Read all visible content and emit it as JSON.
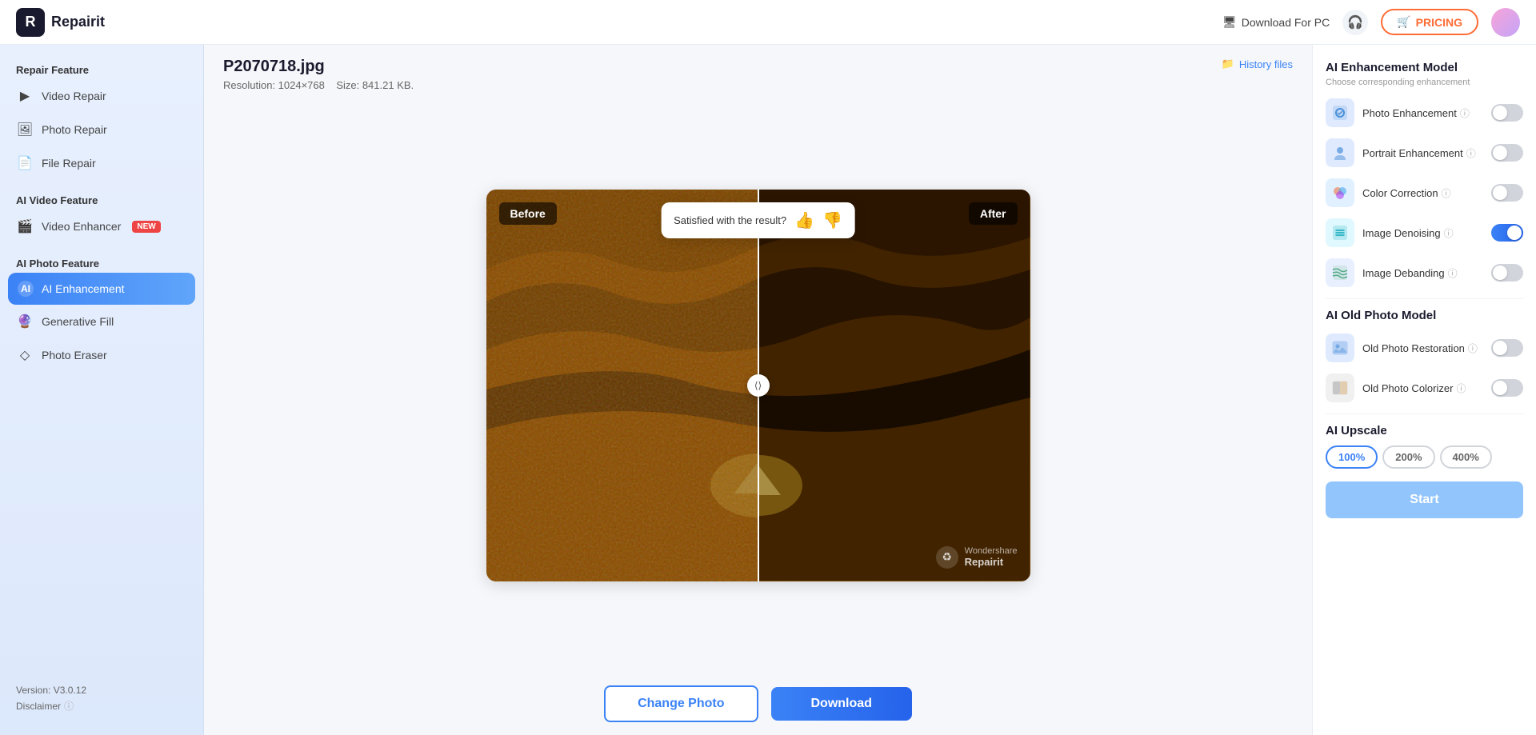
{
  "header": {
    "logo_text": "Repairit",
    "download_pc_label": "Download For PC",
    "pricing_label": "PRICING",
    "pricing_icon": "🛒"
  },
  "sidebar": {
    "repair_feature_label": "Repair Feature",
    "items_repair": [
      {
        "id": "video-repair",
        "label": "Video Repair",
        "icon": "▶"
      },
      {
        "id": "photo-repair",
        "label": "Photo Repair",
        "icon": "🖼"
      },
      {
        "id": "file-repair",
        "label": "File Repair",
        "icon": "📄"
      }
    ],
    "ai_video_label": "AI Video Feature",
    "items_ai_video": [
      {
        "id": "video-enhancer",
        "label": "Video Enhancer",
        "icon": "🎬",
        "badge": "NEW"
      }
    ],
    "ai_photo_label": "AI Photo Feature",
    "items_ai_photo": [
      {
        "id": "ai-enhancement",
        "label": "AI Enhancement",
        "icon": "✨",
        "active": true
      },
      {
        "id": "generative-fill",
        "label": "Generative Fill",
        "icon": "🔮"
      },
      {
        "id": "photo-eraser",
        "label": "Photo Eraser",
        "icon": "◇"
      }
    ],
    "version": "Version: V3.0.12",
    "disclaimer": "Disclaimer"
  },
  "content": {
    "filename": "P2070718.jpg",
    "resolution": "Resolution: 1024×768",
    "size": "Size: 841.21 KB.",
    "history_label": "History files",
    "before_label": "Before",
    "after_label": "After",
    "satisfaction_text": "Satisfied with the result?",
    "watermark_brand": "Wondershare",
    "watermark_product": "Repairit",
    "change_photo_label": "Change Photo",
    "download_label": "Download"
  },
  "right_panel": {
    "model_title": "AI Enhancement Model",
    "model_subtitle": "Choose corresponding enhancement",
    "features": [
      {
        "id": "photo-enhancement",
        "label": "Photo Enhancement",
        "icon": "🖼",
        "icon_class": "icon-photo-enhance",
        "toggled": false
      },
      {
        "id": "portrait-enhancement",
        "label": "Portrait Enhancement",
        "icon": "👤",
        "icon_class": "icon-portrait",
        "toggled": false
      },
      {
        "id": "color-correction",
        "label": "Color Correction",
        "icon": "🎨",
        "icon_class": "icon-color",
        "toggled": false
      },
      {
        "id": "image-denoising",
        "label": "Image Denoising",
        "icon": "✦",
        "icon_class": "icon-denoise",
        "toggled": true
      },
      {
        "id": "image-debanding",
        "label": "Image Debanding",
        "icon": "≋",
        "icon_class": "icon-deband",
        "toggled": false
      }
    ],
    "old_photo_title": "AI Old Photo Model",
    "old_photo_features": [
      {
        "id": "old-photo-restoration",
        "label": "Old Photo Restoration",
        "icon": "📷",
        "icon_class": "icon-old-photo",
        "toggled": false
      },
      {
        "id": "old-photo-colorizer",
        "label": "Old Photo Colorizer",
        "icon": "🎭",
        "icon_class": "icon-old-color",
        "toggled": false
      }
    ],
    "upscale_title": "AI Upscale",
    "upscale_options": [
      "100%",
      "200%",
      "400%"
    ],
    "upscale_selected": "100%",
    "start_label": "Start"
  }
}
